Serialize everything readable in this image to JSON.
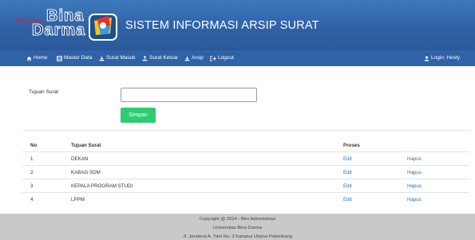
{
  "header": {
    "logo": {
      "small_text": "Universitas",
      "line1": "Bina",
      "line2": "Darma"
    },
    "title": "SISTEM INFORMASI ARSIP SURAT"
  },
  "navbar": {
    "items": [
      {
        "label": "Home",
        "icon": "home-icon"
      },
      {
        "label": "Master Data",
        "icon": "grid-icon"
      },
      {
        "label": "Surat Masuk",
        "icon": "inbox-icon"
      },
      {
        "label": "Surat Keluar",
        "icon": "outbox-icon"
      },
      {
        "label": "Arsip",
        "icon": "archive-icon"
      },
      {
        "label": "Logout",
        "icon": "logout-icon"
      }
    ],
    "user": {
      "label": "Login: Hesty",
      "icon": "user-icon"
    }
  },
  "form": {
    "label": "Tujuan Surat",
    "input_value": "",
    "input_placeholder": "",
    "submit_label": "Simpan"
  },
  "table": {
    "headers": [
      "No",
      "Tujuan Surat",
      "Proses",
      ""
    ],
    "rows": [
      {
        "no": "1",
        "tujuan": "DEKAN",
        "edit": "Edit",
        "hapus": "Hapus"
      },
      {
        "no": "2",
        "tujuan": "KABAG SDM",
        "edit": "Edit",
        "hapus": "Hapus"
      },
      {
        "no": "3",
        "tujuan": "KEPALA PROGRAM STUDI",
        "edit": "Edit",
        "hapus": "Hapus"
      },
      {
        "no": "4",
        "tujuan": "LPPM",
        "edit": "Edit",
        "hapus": "Hapus"
      }
    ]
  },
  "footer": {
    "line1": "Copyright @ 2014 - Biro Administrasi",
    "line2": "Universitas Bina Darma",
    "line3": "Jl. Jenderal A. Yani No. 3 Kampus Utama Palembang"
  },
  "colors": {
    "header_bg": "#3f79bd",
    "navbar_bg": "#2f62a6",
    "submit_bg": "#2ecc71",
    "link": "#2a6fb6",
    "footer_bg": "#c9c9c9"
  }
}
